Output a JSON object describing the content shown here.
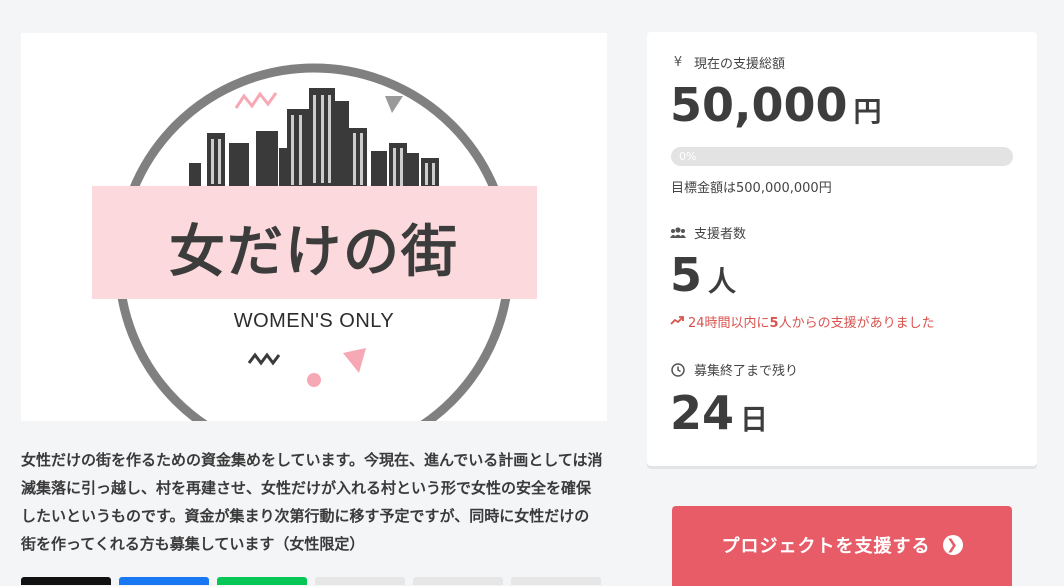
{
  "hero": {
    "title": "女だけの街",
    "subtitle": "WOMEN'S ONLY",
    "colors": {
      "ring": "#808080",
      "banner": "#fbd9dc",
      "accent_pink": "#f6a8b5",
      "city": "#3a3a3a"
    }
  },
  "description": "女性だけの街を作るための資金集めをしています。今現在、進んでいる計画としては消滅集落に引っ越し、村を再建させ、女性だけが入れる村という形で女性の安全を確保したいというものです。資金が集まり次第行動に移す予定ですが、同時に女性だけの街を作ってくれる方も募集しています（女性限定）",
  "stats": {
    "total": {
      "icon": "yen-icon",
      "icon_glyph": "¥",
      "label": "現在の支援総額",
      "value": "50,000",
      "unit": "円"
    },
    "progress": {
      "percent_text": "0%",
      "fraction": 0.0001,
      "goal_text": "目標金額は500,000,000円"
    },
    "supporters": {
      "icon": "users-icon",
      "label": "支援者数",
      "value": "5",
      "unit": "人",
      "trend_prefix": "24時間以内に",
      "trend_count": "5",
      "trend_suffix": "人からの支援がありました"
    },
    "remaining": {
      "icon": "clock-icon",
      "label": "募集終了まで残り",
      "value": "24",
      "unit": "日"
    }
  },
  "cta": {
    "label": "プロジェクトを支援する",
    "icon": "chevron-right-circle-icon",
    "color": "#e85c68"
  },
  "share_buttons": [
    {
      "name": "x",
      "color": "#111111"
    },
    {
      "name": "facebook",
      "color": "#1877f2"
    },
    {
      "name": "line",
      "color": "#06c755"
    },
    {
      "name": "share-4",
      "color": "#e6e6e6"
    },
    {
      "name": "share-5",
      "color": "#e6e6e6"
    },
    {
      "name": "share-6",
      "color": "#e6e6e6"
    }
  ]
}
